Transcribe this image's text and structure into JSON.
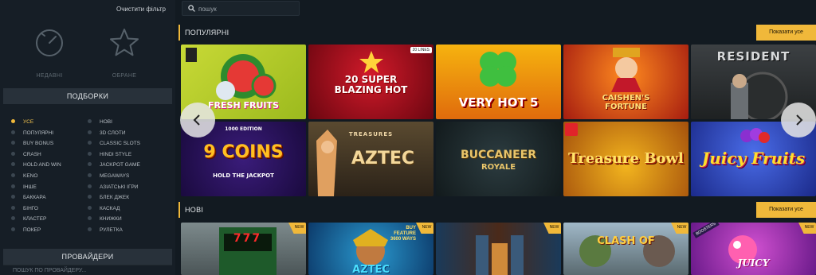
{
  "sidebar": {
    "clear_filter": "Очистити фільтр",
    "recent_label": "НЕДАВНІ",
    "favorites_label": "ОБРАНЕ",
    "collections_title": "ПОДБОРКИ",
    "providers_title": "ПРОВАЙДЕРИ",
    "provider_search_placeholder": "ПОШУК ПО ПРОВАЙДЕРУ...",
    "categories_left": [
      "УСЕ",
      "ПОПУЛЯРНІ",
      "BUY BONUS",
      "CRASH",
      "HOLD AND WIN",
      "KENO",
      "ІНШЕ",
      "БАККАРА",
      "БІНГО",
      "КЛАСТЕР",
      "ПОКЕР"
    ],
    "categories_right": [
      "НОВІ",
      "3D СЛОТИ",
      "CLASSIC SLOTS",
      "HINDI STYLE",
      "JACKPOT GAME",
      "MEGAWAYS",
      "АЗІАТСЬКІ ІГРИ",
      "БЛЕК ДЖЕК",
      "КАСКАД",
      "КНИЖКИ",
      "РУЛЕТКА"
    ],
    "active_category": "УСЕ"
  },
  "search": {
    "placeholder": "пошук"
  },
  "popular": {
    "title": "ПОПУЛЯРНІ",
    "show_all": "Показати усе",
    "games_row1": [
      {
        "title": "FRESH FRUITS"
      },
      {
        "title": "20 SUPER BLAZING HOT",
        "badge": "20 LINES"
      },
      {
        "title": "VERY HOT 5"
      },
      {
        "title": "CAISHEN'S FORTUNE"
      },
      {
        "title": "RESIDENT"
      }
    ],
    "games_row2": [
      {
        "title": "9 COINS",
        "sub": "HOLD THE JACKPOT",
        "edition": "1000 EDITION"
      },
      {
        "title": "AZTEC",
        "pre": "TREASURES"
      },
      {
        "title": "BUCCANEER",
        "sub": "ROYALE"
      },
      {
        "title": "Treasure Bowl"
      },
      {
        "title": "Juicy Fruits"
      }
    ]
  },
  "new": {
    "title": "НОВІ",
    "show_all": "Показати усе",
    "badge": "NEW",
    "games": [
      {
        "title": "777"
      },
      {
        "title": "AZTEC",
        "buy": "BUY FEATURE 3600 WAYS"
      },
      {
        "title": ""
      },
      {
        "title": ""
      },
      {
        "title": "CLASH OF"
      },
      {
        "title": "JUICY"
      }
    ]
  },
  "colors": {
    "accent": "#f0b83a",
    "bg": "#121a21",
    "sidebar": "#161e26"
  }
}
